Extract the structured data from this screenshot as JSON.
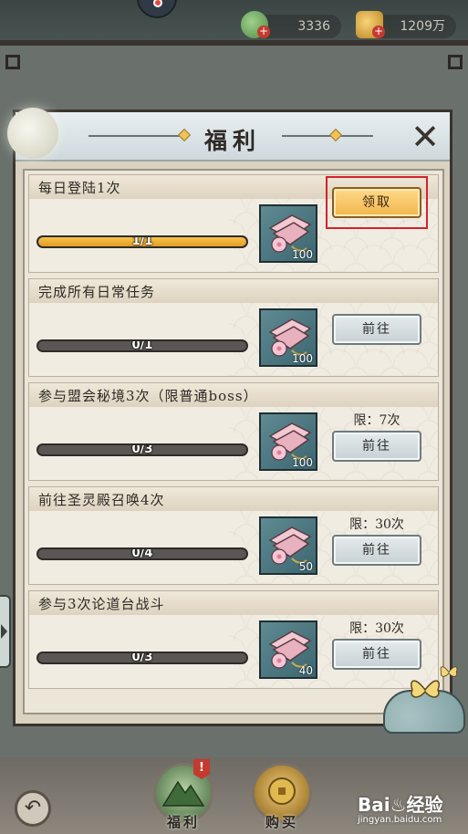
{
  "hud": {
    "currency_green": "3336",
    "currency_gold": "1209万",
    "plus": "+",
    "badge_mark": "!"
  },
  "modal": {
    "title": "福利",
    "close_symbol": "✕"
  },
  "tasks": [
    {
      "title": "每日登陆1次",
      "progress_text": "1/1",
      "progress": 1.0,
      "reward_qty": "100",
      "button": "领取",
      "button_type": "claim",
      "limit": ""
    },
    {
      "title": "完成所有日常任务",
      "progress_text": "0/1",
      "progress": 0.0,
      "reward_qty": "100",
      "button": "前往",
      "button_type": "go",
      "limit": ""
    },
    {
      "title": "参与盟会秘境3次（限普通boss）",
      "progress_text": "0/3",
      "progress": 0.0,
      "reward_qty": "100",
      "button": "前往",
      "button_type": "go",
      "limit": "限：7次"
    },
    {
      "title": "前往圣灵殿召唤4次",
      "progress_text": "0/4",
      "progress": 0.0,
      "reward_qty": "50",
      "button": "前往",
      "button_type": "go",
      "limit": "限：30次"
    },
    {
      "title": "参与3次论道台战斗",
      "progress_text": "0/3",
      "progress": 0.0,
      "reward_qty": "40",
      "button": "前往",
      "button_type": "go",
      "limit": "限：30次"
    }
  ],
  "bottom_nav": {
    "back_symbol": "↶",
    "welfare_label": "福利",
    "buy_label": "购买"
  },
  "watermark": {
    "brand": "Bai♨经验",
    "url": "jingyan.baidu.com"
  },
  "colors": {
    "accent_gold": "#f1b64a",
    "highlight_red": "#d2232a",
    "progress_fill": "#e49d24"
  }
}
